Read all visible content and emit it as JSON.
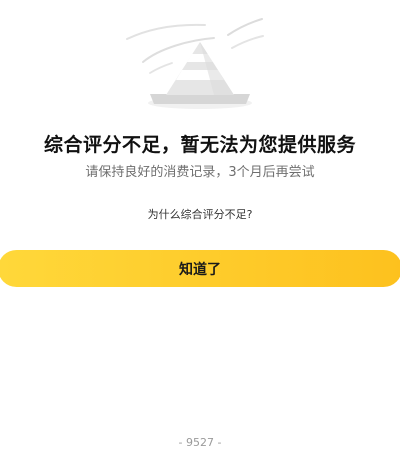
{
  "illustration": {
    "icon": "traffic-cone-icon"
  },
  "headline": "综合评分不足，暂无法为您提供服务",
  "subtext": "请保持良好的消费记录，3个月后再尝试",
  "reason_link": "为什么综合评分不足?",
  "primary_button": {
    "label": "知道了",
    "color_start": "#ffd83a",
    "color_end": "#fdc11e"
  },
  "footer_code": "- 9527 -"
}
